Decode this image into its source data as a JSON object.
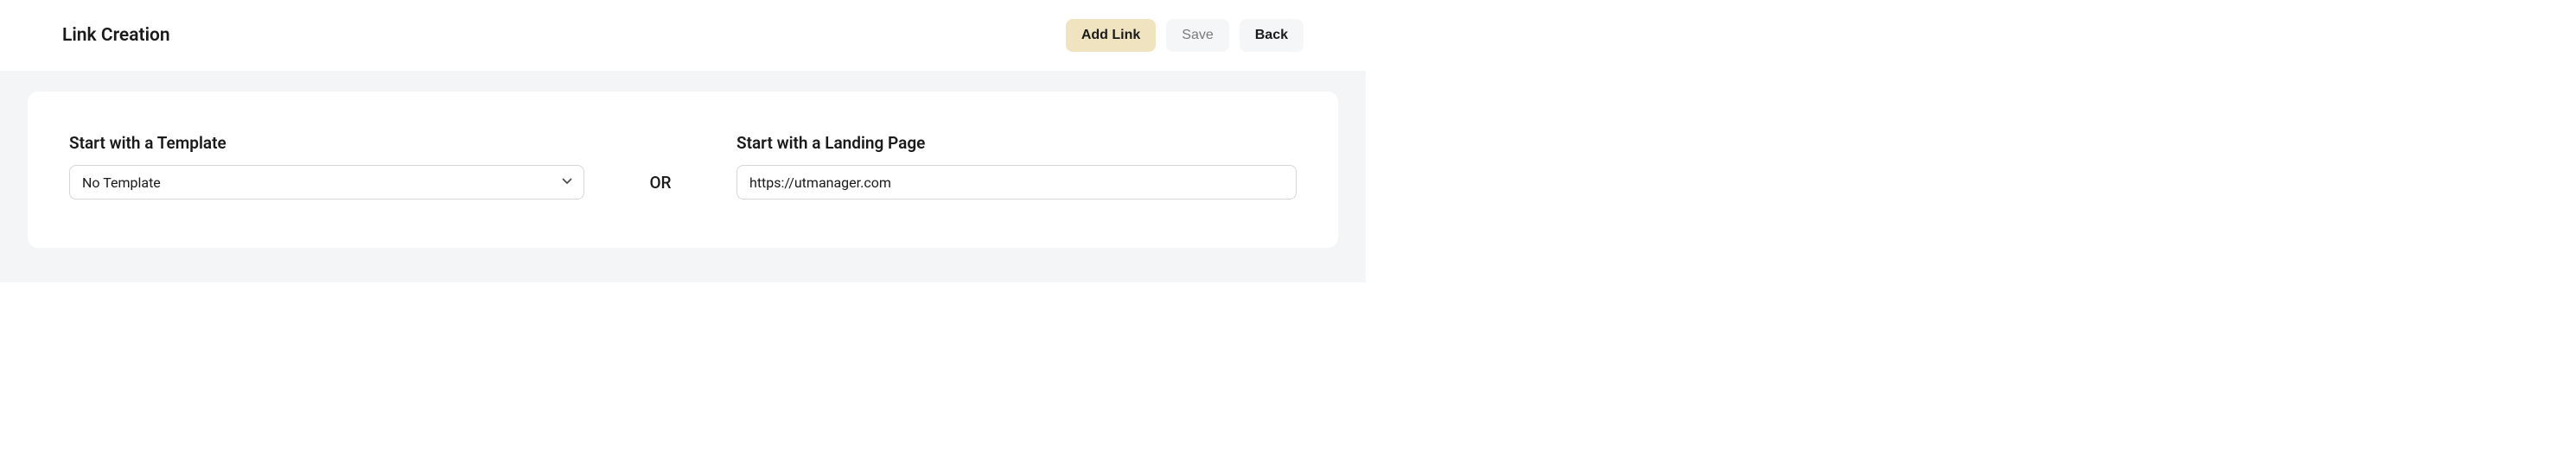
{
  "header": {
    "title": "Link Creation",
    "actions": {
      "add_link_label": "Add Link",
      "save_label": "Save",
      "back_label": "Back"
    }
  },
  "card": {
    "template": {
      "label": "Start with a Template",
      "selected": "No Template",
      "options": [
        "No Template"
      ]
    },
    "divider_text": "OR",
    "landing_page": {
      "label": "Start with a Landing Page",
      "value": "https://utmanager.com"
    }
  }
}
